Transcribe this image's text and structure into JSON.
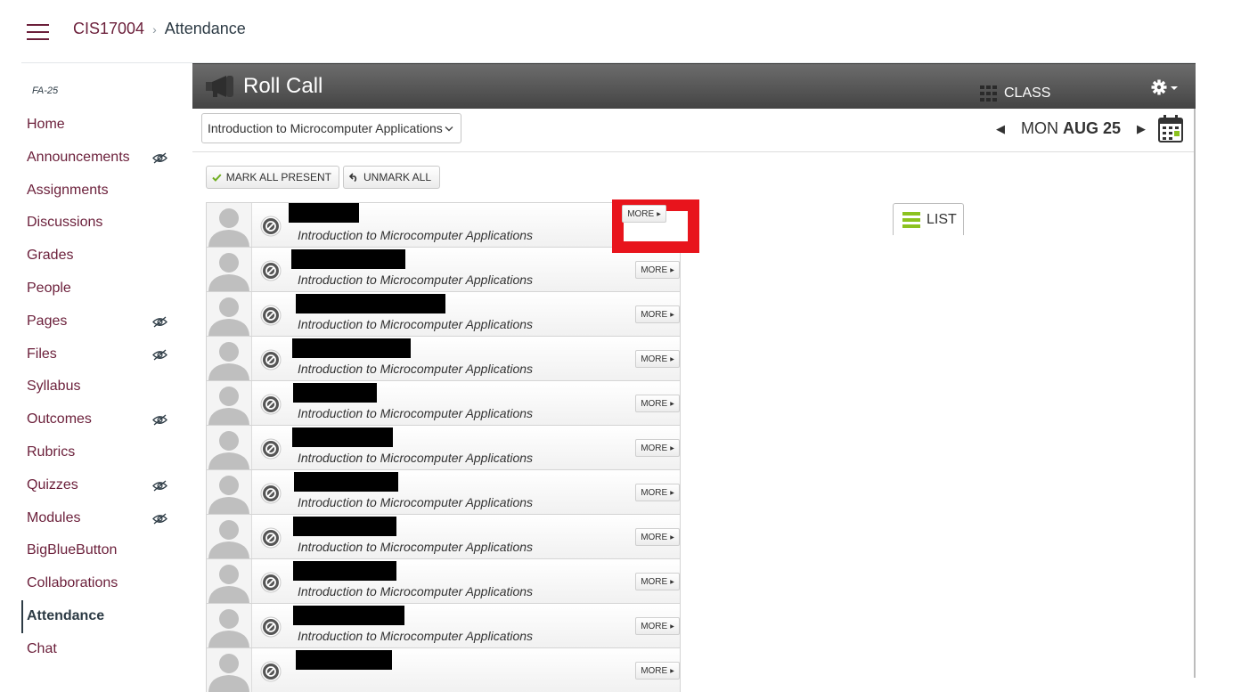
{
  "header": {
    "course_code": "CIS17004",
    "breadcrumb_separator": "›",
    "current_page": "Attendance"
  },
  "sidebar": {
    "term": "FA-25",
    "items": [
      {
        "label": "Home",
        "hidden": false
      },
      {
        "label": "Announcements",
        "hidden": true
      },
      {
        "label": "Assignments",
        "hidden": false
      },
      {
        "label": "Discussions",
        "hidden": false
      },
      {
        "label": "Grades",
        "hidden": false
      },
      {
        "label": "People",
        "hidden": false
      },
      {
        "label": "Pages",
        "hidden": true
      },
      {
        "label": "Files",
        "hidden": true
      },
      {
        "label": "Syllabus",
        "hidden": false
      },
      {
        "label": "Outcomes",
        "hidden": true
      },
      {
        "label": "Rubrics",
        "hidden": false
      },
      {
        "label": "Quizzes",
        "hidden": true
      },
      {
        "label": "Modules",
        "hidden": true
      },
      {
        "label": "BigBlueButton",
        "hidden": false
      },
      {
        "label": "Collaborations",
        "hidden": false
      },
      {
        "label": "Attendance",
        "hidden": false,
        "active": true
      },
      {
        "label": "Chat",
        "hidden": false
      }
    ]
  },
  "app": {
    "title": "Roll Call",
    "tabs": {
      "list": "LIST",
      "class": "CLASS"
    },
    "section_select": "Introduction to Microcomputer Applications",
    "date": {
      "weekday": "MON",
      "month_day": "AUG 25"
    },
    "buttons": {
      "mark_all_present": "MARK ALL PRESENT",
      "unmark_all": "UNMARK ALL"
    },
    "more_label": "MORE",
    "students": [
      {
        "section": "Introduction to Microcomputer Applications"
      },
      {
        "section": "Introduction to Microcomputer Applications"
      },
      {
        "section": "Introduction to Microcomputer Applications"
      },
      {
        "section": "Introduction to Microcomputer Applications"
      },
      {
        "section": "Introduction to Microcomputer Applications"
      },
      {
        "section": "Introduction to Microcomputer Applications"
      },
      {
        "section": "Introduction to Microcomputer Applications"
      },
      {
        "section": "Introduction to Microcomputer Applications"
      },
      {
        "section": "Introduction to Microcomputer Applications"
      },
      {
        "section": "Introduction to Microcomputer Applications"
      },
      {
        "section": ""
      }
    ]
  },
  "colors": {
    "brand": "#6b1f3a",
    "titlebar": "#555555",
    "highlight": "#e8141c",
    "accent_green": "#8cc21f"
  }
}
